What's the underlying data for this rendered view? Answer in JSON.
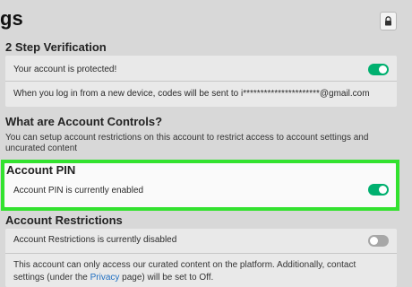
{
  "header": {
    "title": "gs",
    "lock_icon": "lock-icon"
  },
  "two_step": {
    "heading": "2 Step Verification",
    "status_text": "Your account is protected!",
    "toggle_state": "on",
    "info_text": "When you log in from a new device, codes will be sent to i**********************@gmail.com"
  },
  "account_controls": {
    "heading": "What are Account Controls?",
    "description": "You can setup account restrictions on this account to restrict access to account settings and uncurated content"
  },
  "account_pin": {
    "heading": "Account PIN",
    "status_text": "Account PIN is currently enabled",
    "toggle_state": "on"
  },
  "account_restrictions": {
    "heading": "Account Restrictions",
    "status_text": "Account Restrictions is currently disabled",
    "toggle_state": "off",
    "description_part1": "This account can only access our curated content on the platform. Additionally, contact",
    "description_part2_prefix": "settings (under the ",
    "privacy_link": "Privacy",
    "description_part2_suffix": " page) will be set to Off."
  },
  "colors": {
    "toggle_on": "#00b06f",
    "toggle_off": "#a7a7a7",
    "highlight_frame": "#33e22f",
    "link": "#1f6fc2"
  }
}
